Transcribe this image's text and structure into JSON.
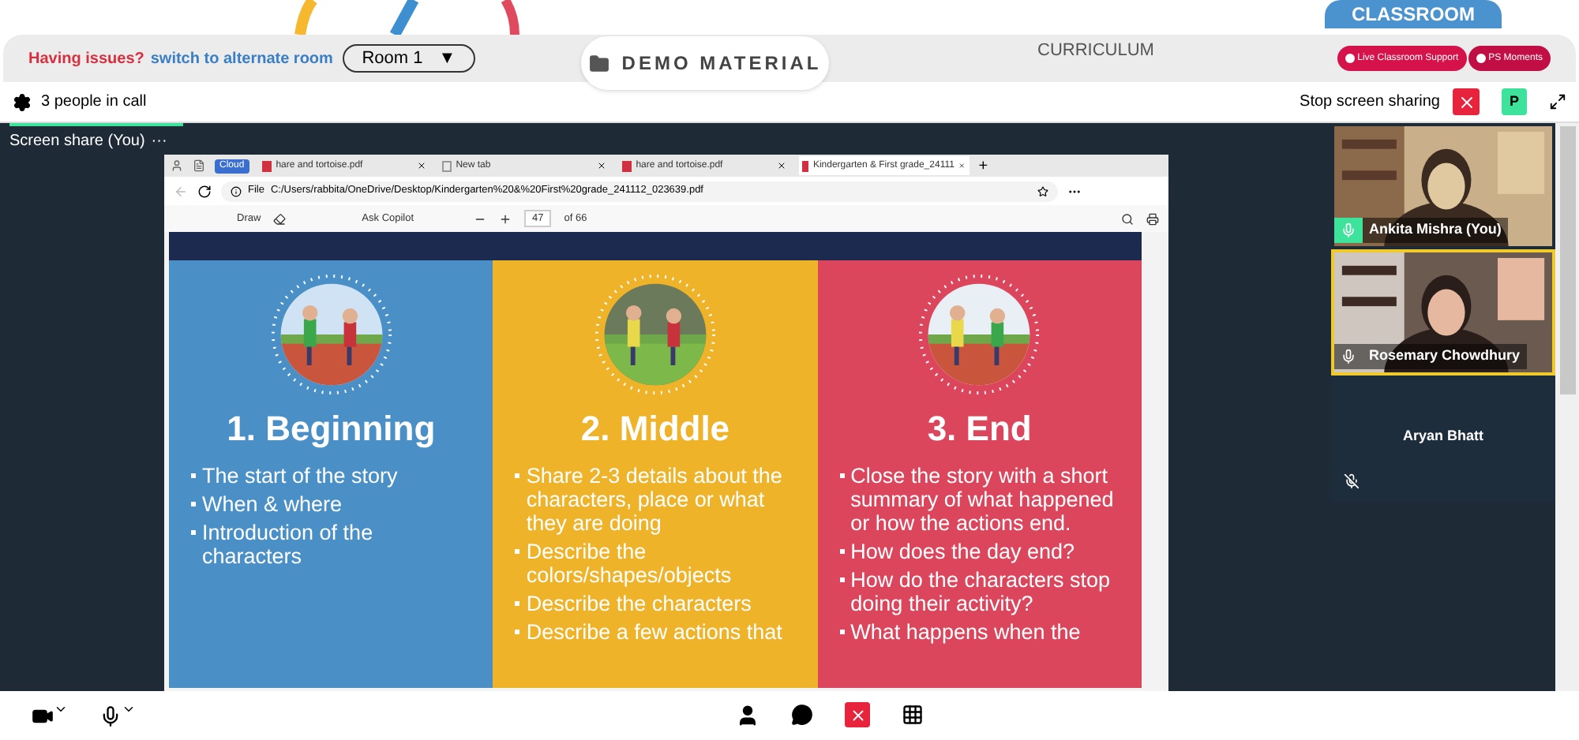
{
  "header": {
    "tab": "CLASSROOM",
    "issue_text": "Having issues?",
    "switch_link": "switch to alternate room",
    "room": "Room 1",
    "room_caret": "▼",
    "demo_button": "DEMO MATERIAL",
    "curriculum": "CURRICULUM",
    "buttons": [
      "Live Classroom Support",
      "PS Moments"
    ]
  },
  "call_bar": {
    "people": "3 people in call",
    "stop_label": "Stop screen sharing",
    "avatar_letter": "P"
  },
  "share": {
    "label": "Screen share (You)",
    "more": "···"
  },
  "browser": {
    "cloud": "Cloud",
    "tabs": [
      {
        "title": "hare and tortoise.pdf",
        "kind": "pdf",
        "selected": false
      },
      {
        "title": "New tab",
        "kind": "blank",
        "selected": false
      },
      {
        "title": "hare and tortoise.pdf",
        "kind": "pdf",
        "selected": false
      },
      {
        "title": "Kindergarten & First grade_24111",
        "kind": "pdf",
        "selected": true
      }
    ],
    "new_tab": "+",
    "file_label": "File",
    "url": "C:/Users/rabbita/OneDrive/Desktop/Kindergarten%20&%20First%20grade_241112_023639.pdf",
    "draw": "Draw",
    "copilot": "Ask Copilot",
    "page": "47",
    "page_total": "of 66"
  },
  "slide": {
    "columns": [
      {
        "heading": "1. Beginning",
        "color": "#4a90c6",
        "bullets": [
          "The start of the story",
          "When & where",
          "Introduction of the characters"
        ]
      },
      {
        "heading": "2. Middle",
        "color": "#efb32a",
        "bullets": [
          "Share 2-3 details about the characters, place or what they are doing",
          "Describe the colors/shapes/objects",
          "Describe the characters",
          "Describe a few actions that"
        ]
      },
      {
        "heading": "3. End",
        "color": "#dc465c",
        "bullets": [
          "Close the story with a short summary of what happened or how the actions end.",
          "How does the day end?",
          "How do the characters stop doing their activity?",
          "What happens when the"
        ]
      }
    ]
  },
  "participants": [
    {
      "name": "Ankita Mishra (You)",
      "kind": "video",
      "speaking": false,
      "muted": false
    },
    {
      "name": "Rosemary Chowdhury",
      "kind": "video",
      "speaking": true,
      "muted": false
    },
    {
      "name": "Aryan Bhatt",
      "kind": "avatar",
      "speaking": false,
      "muted": true
    }
  ]
}
